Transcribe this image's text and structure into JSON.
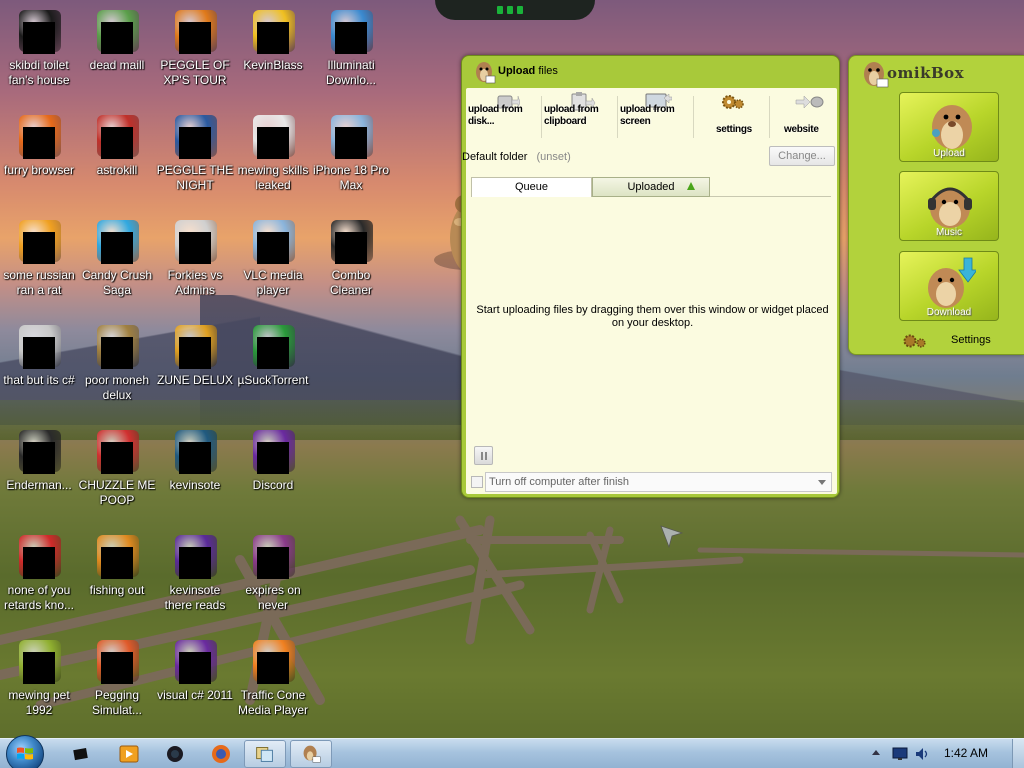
{
  "desktop": {
    "icons": [
      {
        "label": "skibdi toilet fan's house",
        "art": "trash-can-icon",
        "color": "#1b1b1b"
      },
      {
        "label": "dead maill",
        "art": "mail-icon",
        "color": "#5a9f4a"
      },
      {
        "label": "PEGGLE OF XP'S TOUR",
        "art": "peggle-icon",
        "color": "#e07a1a"
      },
      {
        "label": "KevinBlass",
        "art": "sun-icon",
        "color": "#f0c020"
      },
      {
        "label": "Illuminati Downlo...",
        "art": "globe-download-icon",
        "color": "#3a8ad0"
      },
      {
        "label": "furry browser",
        "art": "firefox-icon",
        "color": "#e66a1a"
      },
      {
        "label": "astrokill",
        "art": "game-icon",
        "color": "#c0302a"
      },
      {
        "label": "PEGGLE THE NIGHT",
        "art": "peggle-night-icon",
        "color": "#2a5aa0"
      },
      {
        "label": "mewing skills leaked",
        "art": "document-icon",
        "color": "#e8e8e8"
      },
      {
        "label": "iPhone 18 Pro Max",
        "art": "window-icon",
        "color": "#8ab4dc"
      },
      {
        "label": "some russian ran a rat",
        "art": "ie-icon",
        "color": "#f0a020"
      },
      {
        "label": "Candy Crush Saga",
        "art": "candy-icon",
        "color": "#30a8e0"
      },
      {
        "label": "Forkies vs Admins",
        "art": "flower-icon",
        "color": "#d0d0d0"
      },
      {
        "label": "VLC media player",
        "art": "media-icon",
        "color": "#8ab4dc"
      },
      {
        "label": "Combo Cleaner",
        "art": "terminal-icon",
        "color": "#2a2a2a"
      },
      {
        "label": "that but its c#",
        "art": "copy-icon",
        "color": "#c8c8c8"
      },
      {
        "label": "poor moneh delux",
        "art": "bag-icon",
        "color": "#a08040"
      },
      {
        "label": "ZUNE DELUX",
        "art": "zune-icon",
        "color": "#e0a020"
      },
      {
        "label": "µSuckTorrent",
        "art": "torrent-icon",
        "color": "#2a9a3a"
      },
      {
        "label": "",
        "art": "",
        "color": ""
      },
      {
        "label": "Enderman...",
        "art": "terminal-icon",
        "color": "#2a2a2a"
      },
      {
        "label": "CHUZZLE ME POOP",
        "art": "chuzzle-icon",
        "color": "#d03030"
      },
      {
        "label": "kevinsote",
        "art": "app-icon",
        "color": "#205a80"
      },
      {
        "label": "Discord",
        "art": "yahoo-icon",
        "color": "#6a2aa0"
      },
      {
        "label": "",
        "art": "",
        "color": ""
      },
      {
        "label": "none of you retards kno...",
        "art": "chrome-icon",
        "color": "#d02a2a"
      },
      {
        "label": "fishing out",
        "art": "fish-icon",
        "color": "#e08a20"
      },
      {
        "label": "kevinsote there reads",
        "art": "vs-icon",
        "color": "#5a2a9a"
      },
      {
        "label": "expires on never",
        "art": "rar-icon",
        "color": "#8a3a8a"
      },
      {
        "label": "",
        "art": "",
        "color": ""
      },
      {
        "label": "mewing pet 1992",
        "art": "box-icon",
        "color": "#90b030"
      },
      {
        "label": "Pegging Simulat...",
        "art": "peggle-icon",
        "color": "#e05a2a"
      },
      {
        "label": "visual c# 2011",
        "art": "vs-icon",
        "color": "#6a2aa0"
      },
      {
        "label": "Traffic Cone Media Player",
        "art": "vlc-icon",
        "color": "#f08020"
      }
    ]
  },
  "upload_window": {
    "title_bold": "Upload",
    "title_rest": " files",
    "toolbar": [
      {
        "label": "upload from disk...",
        "icon": "disk-upload-icon"
      },
      {
        "label": "upload from clipboard",
        "icon": "clipboard-upload-icon"
      },
      {
        "label": "upload from screen",
        "icon": "screen-upload-icon"
      },
      {
        "label": "settings",
        "icon": "gears-icon"
      },
      {
        "label": "website",
        "icon": "website-icon"
      }
    ],
    "default_folder_label": "Default folder",
    "default_folder_value": "(unset)",
    "change_button": "Change...",
    "tab_queue": "Queue",
    "tab_uploaded": "Uploaded",
    "empty_message": "Start uploading files by dragging them over this window or widget placed on your desktop.",
    "finish_option": "Turn off computer after finish"
  },
  "widget": {
    "brand": "omikBox",
    "buttons": [
      {
        "label": "Upload"
      },
      {
        "label": "Music"
      },
      {
        "label": "Download"
      }
    ],
    "settings_label": "Settings"
  },
  "taskbar": {
    "clock": "1:42 AM"
  },
  "colors": {
    "window_green": "#a8c93a",
    "widget_green": "#b2d23c",
    "panel_cream": "#fbfbe0",
    "taskbar_blue": "#a6c3de"
  }
}
